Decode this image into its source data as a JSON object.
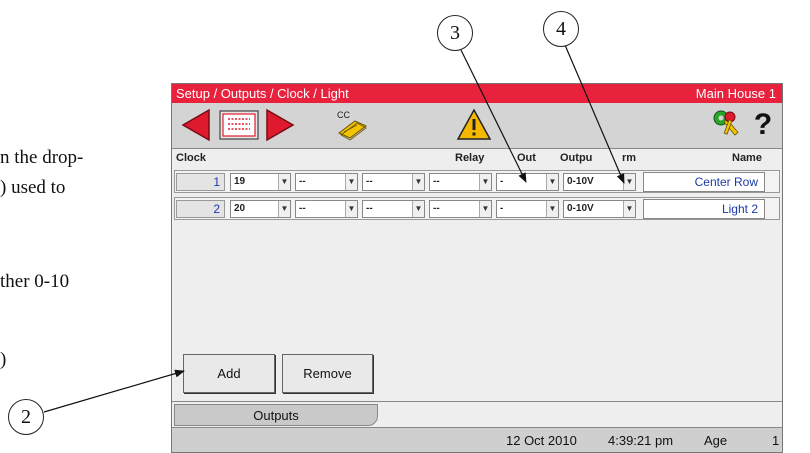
{
  "doc": {
    "line1": "n the drop-",
    "line2": ") used to",
    "line3": "ther 0-10",
    "line4": ")"
  },
  "callouts": {
    "c2": "2",
    "c3": "3",
    "c4": "4"
  },
  "panel": {
    "title": "Setup / Outputs / Clock / Light",
    "location": "Main House 1",
    "toolbar": {
      "back_icon": "left-arrow-icon",
      "list_icon": "list-icon",
      "forward_icon": "right-arrow-icon",
      "cc_icon": "copy-cc-icon",
      "cc_label": "CC",
      "warning_icon": "warning-triangle-icon",
      "keys_icon": "keys-icon",
      "help_icon": "help-icon",
      "help_label": "?"
    },
    "headers": {
      "clock": "Clock",
      "relay": "Relay",
      "out": "Out",
      "output": "Outpu",
      "rm": "rm",
      "name": "Name"
    },
    "rows": [
      {
        "num": "1",
        "relay": "19",
        "c2": "--",
        "c3": "--",
        "c4": "--",
        "c5": "-",
        "output": "0-10V",
        "form": "",
        "name": "Center Row"
      },
      {
        "num": "2",
        "relay": "20",
        "c2": "--",
        "c3": "--",
        "c4": "--",
        "c5": "-",
        "output": "0-10V",
        "form": "",
        "name": "Light 2"
      }
    ],
    "add_label": "Add",
    "remove_label": "Remove",
    "tab_label": "Outputs",
    "status": {
      "date": "12 Oct 2010",
      "time": "4:39:21 pm",
      "age_label": "Age",
      "age_value": "1"
    }
  },
  "colors": {
    "title_bar": "#e8213d",
    "arrow_red": "#e01a2e",
    "value_blue": "#1a3aa5",
    "warning_yellow": "#f5b800"
  }
}
